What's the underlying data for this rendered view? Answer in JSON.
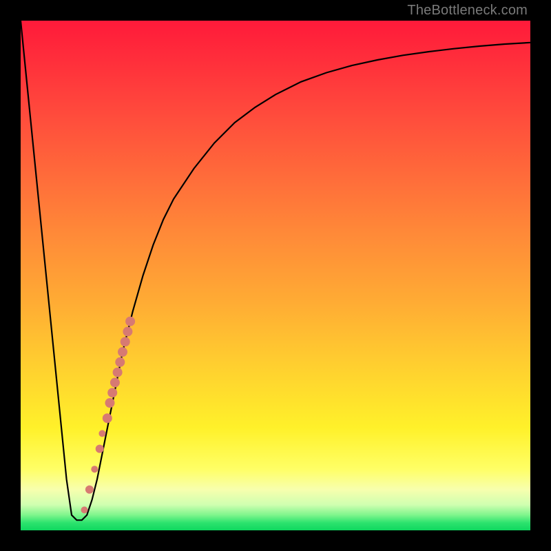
{
  "watermark": "TheBottleneck.com",
  "chart_data": {
    "type": "line",
    "title": "",
    "xlabel": "",
    "ylabel": "",
    "xlim": [
      0,
      100
    ],
    "ylim": [
      0,
      100
    ],
    "grid": false,
    "series": [
      {
        "name": "bottleneck-curve",
        "color": "#000000",
        "x": [
          0,
          2,
          4,
          6,
          8,
          9,
          10,
          11,
          12,
          13,
          14,
          15,
          16,
          18,
          20,
          22,
          24,
          26,
          28,
          30,
          34,
          38,
          42,
          46,
          50,
          55,
          60,
          65,
          70,
          75,
          80,
          85,
          90,
          95,
          100
        ],
        "y": [
          100,
          80,
          60,
          40,
          20,
          10,
          3,
          2,
          2,
          3,
          6,
          10,
          15,
          25,
          35,
          43,
          50,
          56,
          61,
          65,
          71,
          76,
          80,
          83,
          85.5,
          88,
          89.8,
          91.2,
          92.3,
          93.2,
          93.9,
          94.5,
          95,
          95.4,
          95.7
        ]
      }
    ],
    "highlight_points": {
      "name": "highlight-dots",
      "color": "#d77a72",
      "points": [
        {
          "x": 12.5,
          "y": 4,
          "r": 5
        },
        {
          "x": 13.5,
          "y": 8,
          "r": 6
        },
        {
          "x": 14.5,
          "y": 12,
          "r": 5
        },
        {
          "x": 15.5,
          "y": 16,
          "r": 6
        },
        {
          "x": 16.0,
          "y": 19,
          "r": 5
        },
        {
          "x": 17.0,
          "y": 22,
          "r": 7
        },
        {
          "x": 17.5,
          "y": 25,
          "r": 7
        },
        {
          "x": 18.0,
          "y": 27,
          "r": 7
        },
        {
          "x": 18.5,
          "y": 29,
          "r": 7
        },
        {
          "x": 19.0,
          "y": 31,
          "r": 7
        },
        {
          "x": 19.5,
          "y": 33,
          "r": 7
        },
        {
          "x": 20.0,
          "y": 35,
          "r": 7
        },
        {
          "x": 20.5,
          "y": 37,
          "r": 7
        },
        {
          "x": 21.0,
          "y": 39,
          "r": 7
        },
        {
          "x": 21.5,
          "y": 41,
          "r": 7
        }
      ]
    }
  }
}
